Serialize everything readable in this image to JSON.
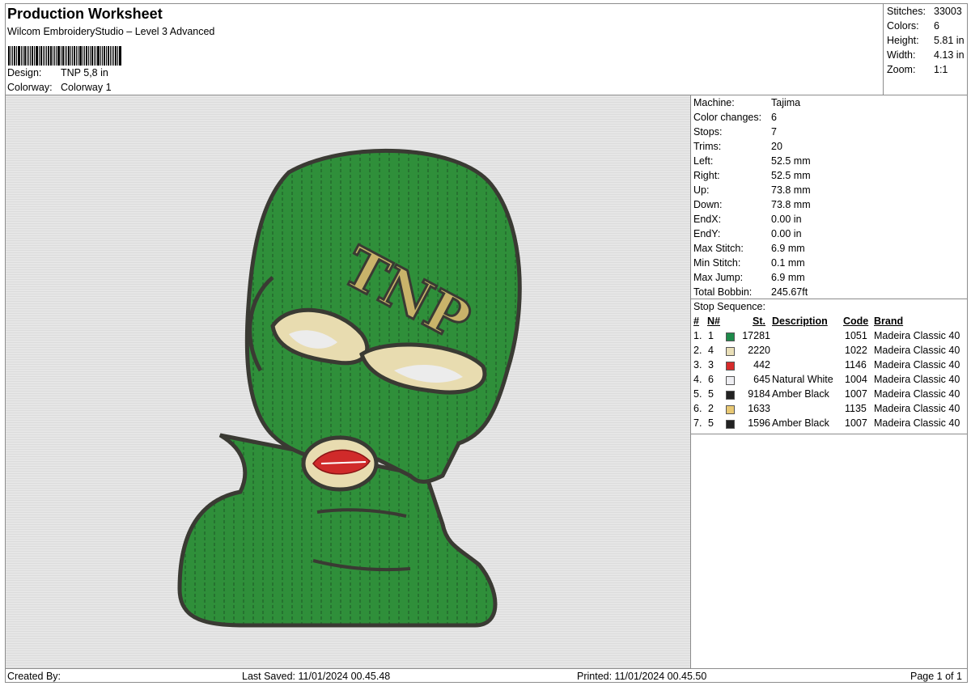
{
  "header": {
    "title": "Production Worksheet",
    "subtitle": "Wilcom EmbroideryStudio – Level 3 Advanced",
    "design_label": "Design:",
    "design_value": "TNP 5,8 in",
    "colorway_label": "Colorway:",
    "colorway_value": "Colorway 1"
  },
  "summary": [
    {
      "k": "Stitches:",
      "v": "33003"
    },
    {
      "k": "Colors:",
      "v": "6"
    },
    {
      "k": "Height:",
      "v": "5.81 in"
    },
    {
      "k": "Width:",
      "v": "4.13 in"
    },
    {
      "k": "Zoom:",
      "v": "1:1"
    }
  ],
  "design_art": {
    "text": "TNP",
    "colors": {
      "green": "#2f8f3a",
      "outline": "#3a3a33",
      "gold": "#c9b36a",
      "cream": "#e8dcb0",
      "lips": "#d02a2a",
      "white": "#ececec"
    }
  },
  "properties": [
    {
      "k": "Machine:",
      "v": "Tajima"
    },
    {
      "k": "Color changes:",
      "v": "6"
    },
    {
      "k": "Stops:",
      "v": "7"
    },
    {
      "k": "Trims:",
      "v": "20"
    },
    {
      "k": "Left:",
      "v": "52.5 mm"
    },
    {
      "k": "Right:",
      "v": "52.5 mm"
    },
    {
      "k": "Up:",
      "v": "73.8 mm"
    },
    {
      "k": "Down:",
      "v": "73.8 mm"
    },
    {
      "k": "EndX:",
      "v": "0.00 in"
    },
    {
      "k": "EndY:",
      "v": "0.00 in"
    },
    {
      "k": "Max Stitch:",
      "v": "6.9 mm"
    },
    {
      "k": "Min Stitch:",
      "v": "0.1 mm"
    },
    {
      "k": "Max Jump:",
      "v": "6.9 mm"
    },
    {
      "k": "Total Bobbin:",
      "v": "245.67ft"
    }
  ],
  "stop_sequence": {
    "title": "Stop Sequence:",
    "headers": {
      "num": "#",
      "needle": "N#",
      "stitches": "St.",
      "description": "Description",
      "code": "Code",
      "brand": "Brand"
    },
    "rows": [
      {
        "num": "1.",
        "needle": "1",
        "color": "#1e8a4a",
        "stitches": "17281",
        "description": "",
        "code": "1051",
        "brand": "Madeira Classic 40"
      },
      {
        "num": "2.",
        "needle": "4",
        "color": "#e9dfb8",
        "stitches": "2220",
        "description": "",
        "code": "1022",
        "brand": "Madeira Classic 40"
      },
      {
        "num": "3.",
        "needle": "3",
        "color": "#d62b2b",
        "stitches": "442",
        "description": "",
        "code": "1146",
        "brand": "Madeira Classic 40"
      },
      {
        "num": "4.",
        "needle": "6",
        "color": "#eeeef2",
        "stitches": "645",
        "description": "Natural White",
        "code": "1004",
        "brand": "Madeira Classic 40"
      },
      {
        "num": "5.",
        "needle": "5",
        "color": "#222222",
        "stitches": "9184",
        "description": "Amber Black",
        "code": "1007",
        "brand": "Madeira Classic 40"
      },
      {
        "num": "6.",
        "needle": "2",
        "color": "#e8c873",
        "stitches": "1633",
        "description": "",
        "code": "1135",
        "brand": "Madeira Classic 40"
      },
      {
        "num": "7.",
        "needle": "5",
        "color": "#222222",
        "stitches": "1596",
        "description": "Amber Black",
        "code": "1007",
        "brand": "Madeira Classic 40"
      }
    ]
  },
  "footer": {
    "created_by": "Created By:",
    "last_saved": "Last Saved: 11/01/2024 00.45.48",
    "printed": "Printed: 11/01/2024 00.45.50",
    "page": "Page 1 of 1"
  }
}
